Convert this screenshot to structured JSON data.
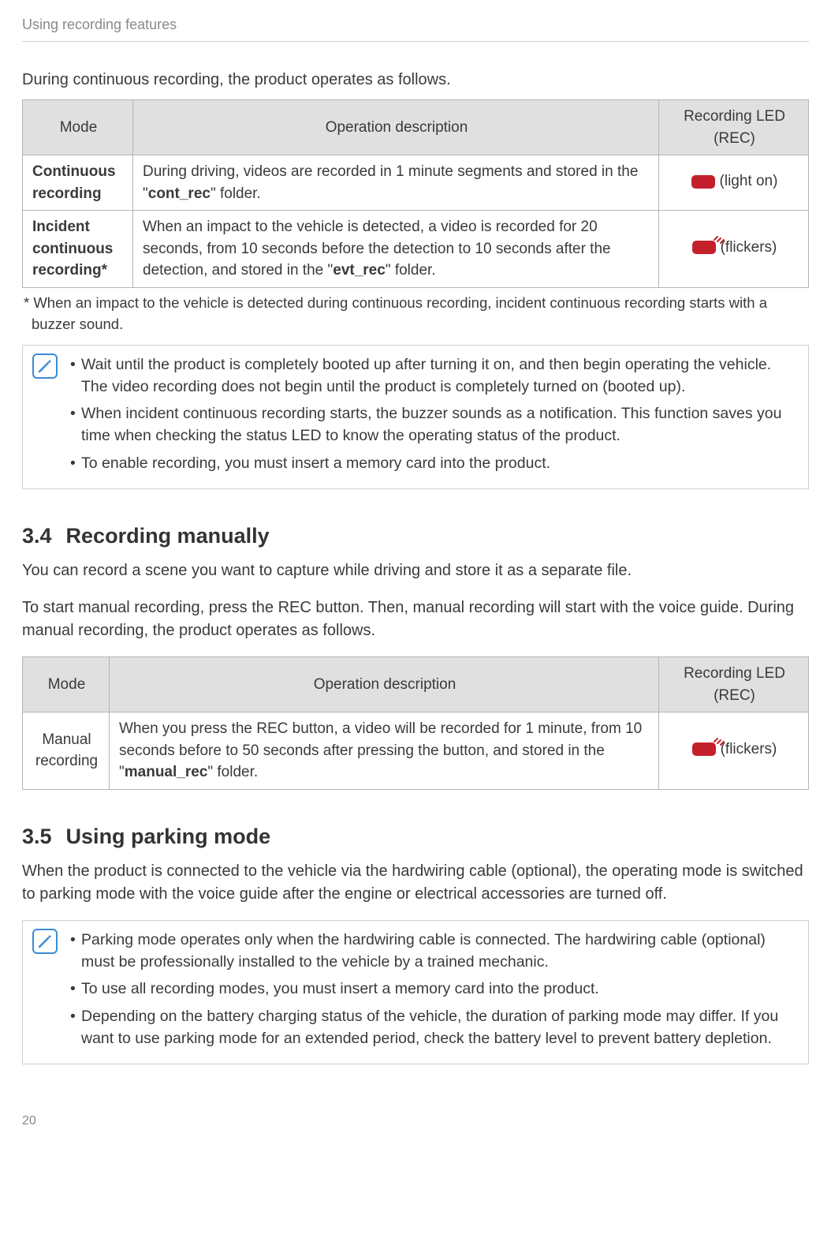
{
  "header": {
    "title": "Using recording features"
  },
  "continuous": {
    "intro": "During continuous recording, the product operates as follows.",
    "table": {
      "headers": {
        "mode": "Mode",
        "desc": "Operation description",
        "led": "Recording LED (REC)"
      },
      "rows": [
        {
          "mode": "Continuous recording",
          "desc_pre": "During driving, videos are recorded in 1 minute segments and stored in the \"",
          "desc_bold": "cont_rec",
          "desc_post": "\" folder.",
          "led_label": "(light on)",
          "flicker": false
        },
        {
          "mode": "Incident continuous recording*",
          "desc_pre": "When an impact to the vehicle is detected, a video is recorded for 20 seconds, from 10 seconds before the detection to 10 seconds after the detection, and stored in the \"",
          "desc_bold": "evt_rec",
          "desc_post": "\" folder.",
          "led_label": "(flickers)",
          "flicker": true
        }
      ]
    },
    "footnote": "* When an impact to the vehicle is detected during continuous recording, incident continuous recording starts with a buzzer sound.",
    "note_bullets": [
      "Wait until the product is completely booted up after turning it on, and then begin operating the vehicle. The video recording does not begin until the product is completely turned on (booted up).",
      "When incident continuous recording starts, the buzzer sounds as a notification. This function saves you time when checking the status LED to know the operating status of the product.",
      "To enable recording, you must insert a memory card into the product."
    ]
  },
  "manual": {
    "number": "3.4",
    "title": "Recording manually",
    "p1": "You can record a scene you want to capture while driving and store it as a separate file.",
    "p2": "To start manual recording, press the REC button. Then, manual recording will start with the voice guide. During manual recording, the product operates as follows.",
    "table": {
      "headers": {
        "mode": "Mode",
        "desc": "Operation description",
        "led": "Recording LED (REC)"
      },
      "row": {
        "mode": "Manual recording",
        "desc_pre": "When you press the REC button, a video will be recorded for 1 minute, from 10 seconds before to 50 seconds after pressing the button, and stored in the \"",
        "desc_bold": "manual_rec",
        "desc_post": "\" folder.",
        "led_label": "(flickers)"
      }
    }
  },
  "parking": {
    "number": "3.5",
    "title": "Using parking mode",
    "p1": "When the product is connected to the vehicle via the hardwiring cable (optional), the operating mode is switched to parking mode with the voice guide after the engine or electrical accessories are turned off.",
    "note_bullets": [
      "Parking mode operates only when the hardwiring cable is connected. The hardwiring cable (optional) must be professionally installed to the vehicle by a trained mechanic.",
      "To use all recording modes, you must insert a memory card into the product.",
      "Depending on the battery charging status of the vehicle, the duration of parking mode may differ. If you want to use parking mode for an extended period, check the battery level to prevent battery depletion."
    ]
  },
  "page_number": "20"
}
